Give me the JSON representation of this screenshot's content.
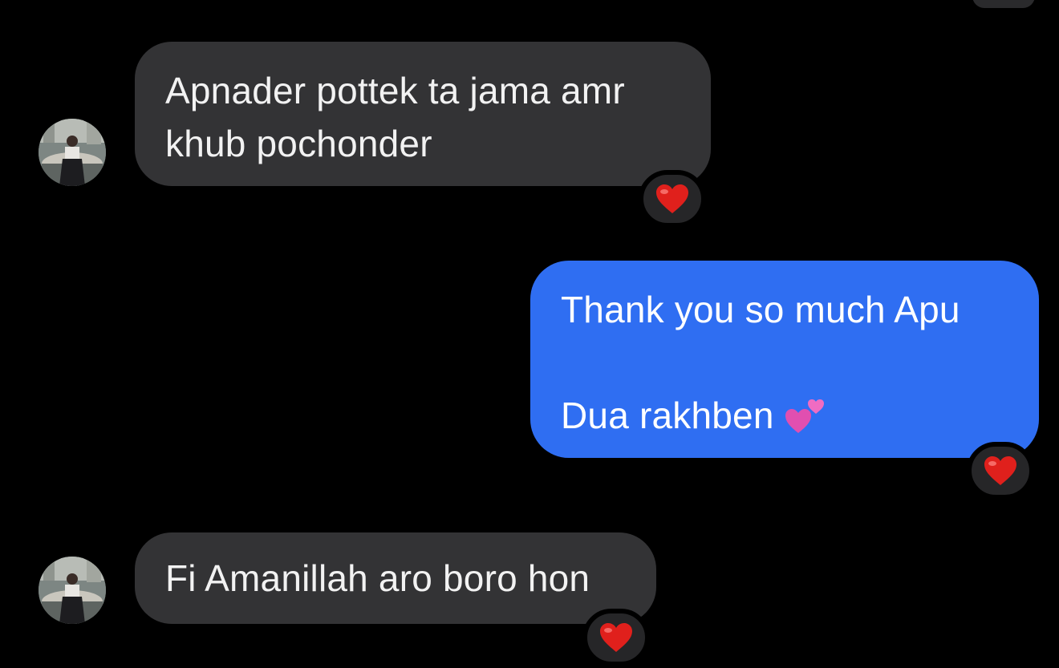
{
  "messages": [
    {
      "direction": "incoming",
      "lines": [
        "Apnader pottek ta jama amr",
        "khub pochonder"
      ],
      "reaction": "heart"
    },
    {
      "direction": "outgoing",
      "lines": [
        "Thank you so much Apu",
        "",
        "Dua rakhben"
      ],
      "trailing_emoji": "two-hearts",
      "reaction": "heart"
    },
    {
      "direction": "incoming",
      "lines": [
        "Fi Amanillah aro boro hon"
      ],
      "reaction": "heart"
    }
  ],
  "colors": {
    "background": "#000000",
    "incoming_bubble": "#333335",
    "outgoing_bubble": "#2f6ef2",
    "reaction_pill": "#262628",
    "heart": "#e0201c"
  }
}
